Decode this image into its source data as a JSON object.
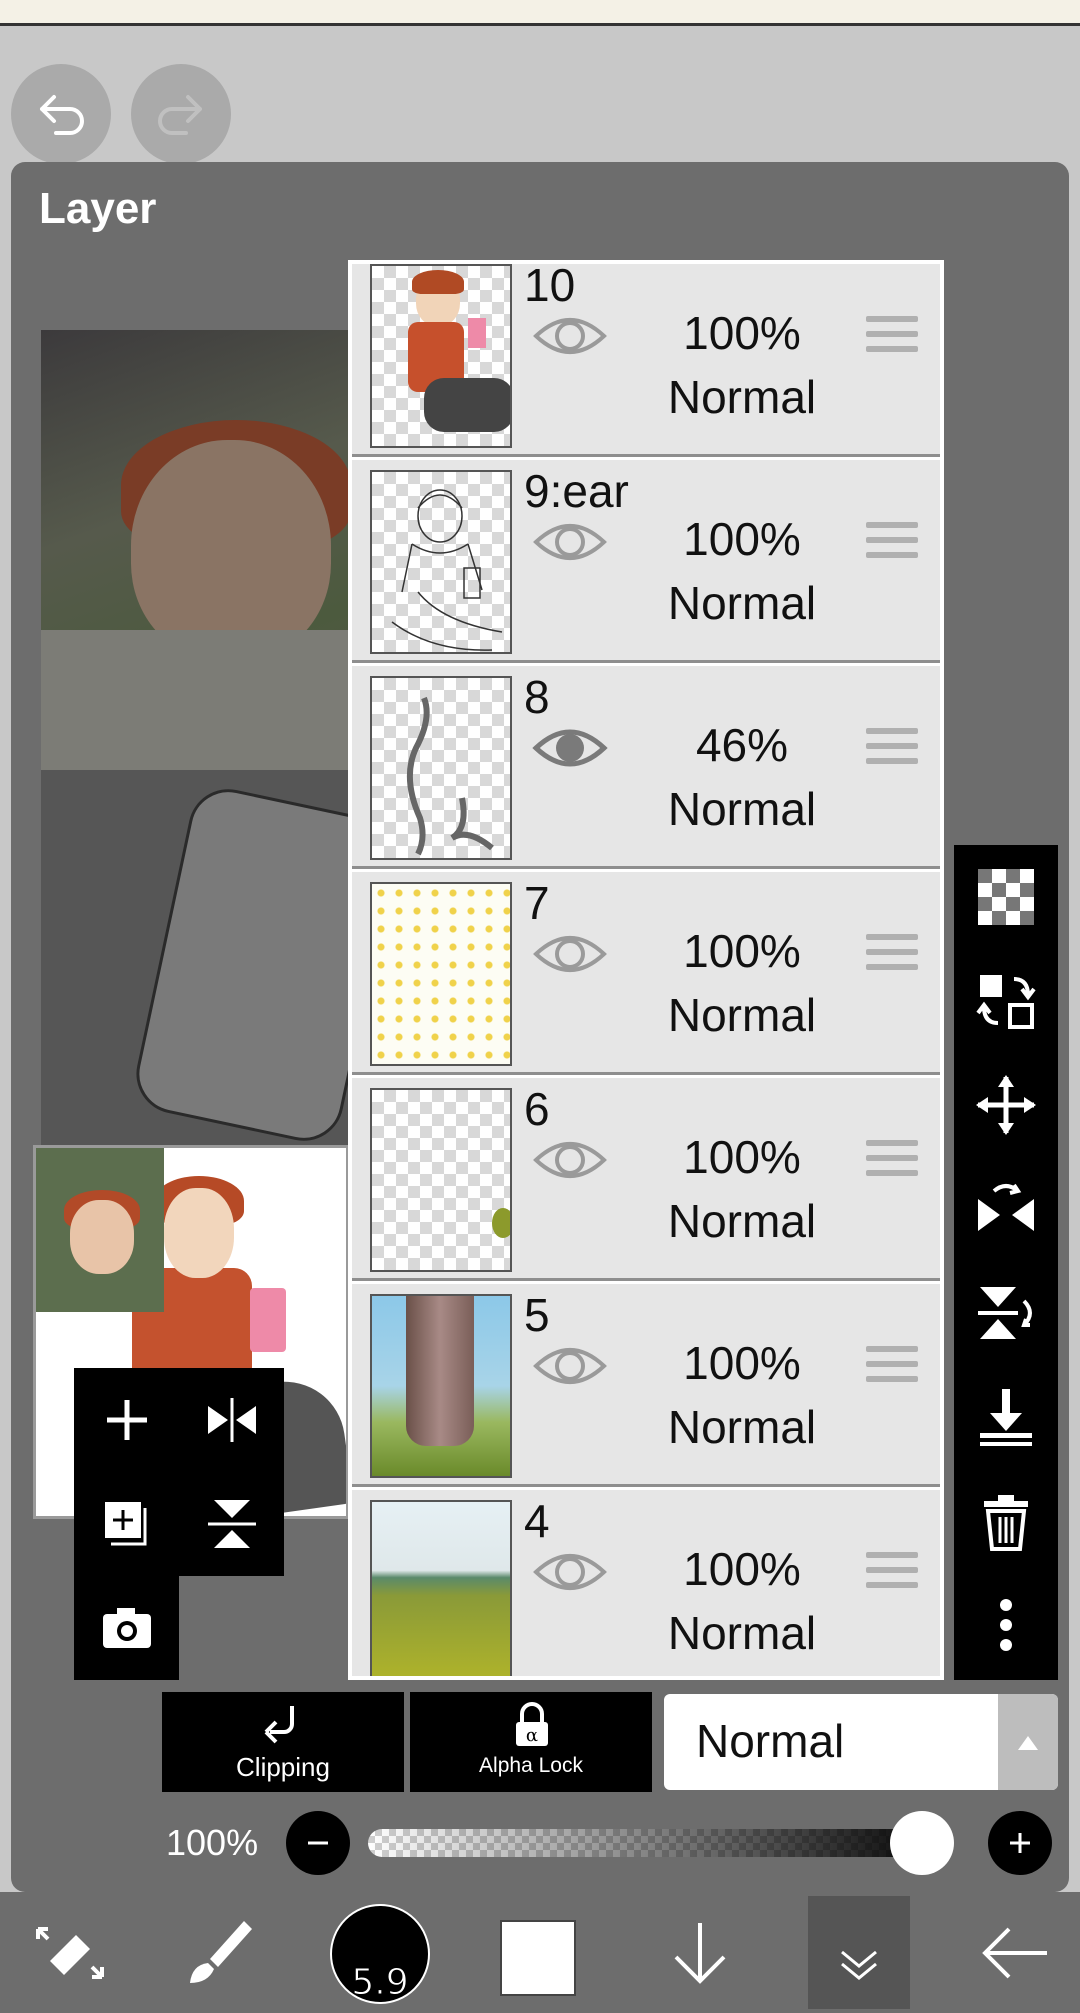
{
  "app": {
    "panel_title": "Layer"
  },
  "topbar": {
    "undo_icon": "undo-icon",
    "redo_icon": "redo-icon"
  },
  "layers": [
    {
      "name": "10",
      "opacity": "100%",
      "blend": "Normal",
      "visible": true
    },
    {
      "name": "9:ear",
      "opacity": "100%",
      "blend": "Normal",
      "visible": true
    },
    {
      "name": "8",
      "opacity": "46%",
      "blend": "Normal",
      "visible": true,
      "eye_active": true
    },
    {
      "name": "7",
      "opacity": "100%",
      "blend": "Normal",
      "visible": true
    },
    {
      "name": "6",
      "opacity": "100%",
      "blend": "Normal",
      "visible": true
    },
    {
      "name": "5",
      "opacity": "100%",
      "blend": "Normal",
      "visible": true
    },
    {
      "name": "4",
      "opacity": "100%",
      "blend": "Normal",
      "visible": true
    }
  ],
  "bottom_controls": {
    "clipping_label": "Clipping",
    "alpha_lock_label": "Alpha Lock",
    "blend_mode": "Normal",
    "opacity_label": "100%",
    "opacity_value": 1.0
  },
  "toolbar": {
    "brush_size": "5.9",
    "color": "#ffffff"
  },
  "colors": {
    "panel": "#6d6d6d",
    "toolbar": "#000000",
    "row": "#e6e6e6"
  }
}
